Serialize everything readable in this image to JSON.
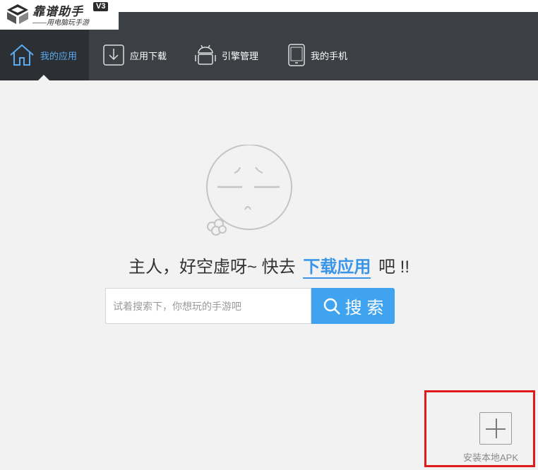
{
  "app": {
    "name": "靠谱助手",
    "version": "V3",
    "slogan": "——用电脑玩手游"
  },
  "nav": {
    "items": [
      {
        "label": "我的应用",
        "icon": "home-icon",
        "active": true
      },
      {
        "label": "应用下载",
        "icon": "download-icon",
        "active": false
      },
      {
        "label": "引擎管理",
        "icon": "android-icon",
        "active": false
      },
      {
        "label": "我的手机",
        "icon": "phone-icon",
        "active": false
      }
    ]
  },
  "main": {
    "empty_face_icon": "sad-face-icon",
    "message_prefix": "主人，好空虚呀~ 快去",
    "message_link": "下载应用",
    "message_suffix": "吧 !!",
    "search": {
      "placeholder": "试着搜索下，你想玩的手游吧",
      "value": "",
      "button_label": "搜 索"
    },
    "install_local": {
      "label": "安装本地APK",
      "icon": "plus-icon"
    }
  },
  "colors": {
    "accent": "#3fa3ef",
    "nav_bg": "#3c3f44",
    "nav_active_bg": "#2c2f33",
    "highlight_border": "#e01b1b"
  }
}
